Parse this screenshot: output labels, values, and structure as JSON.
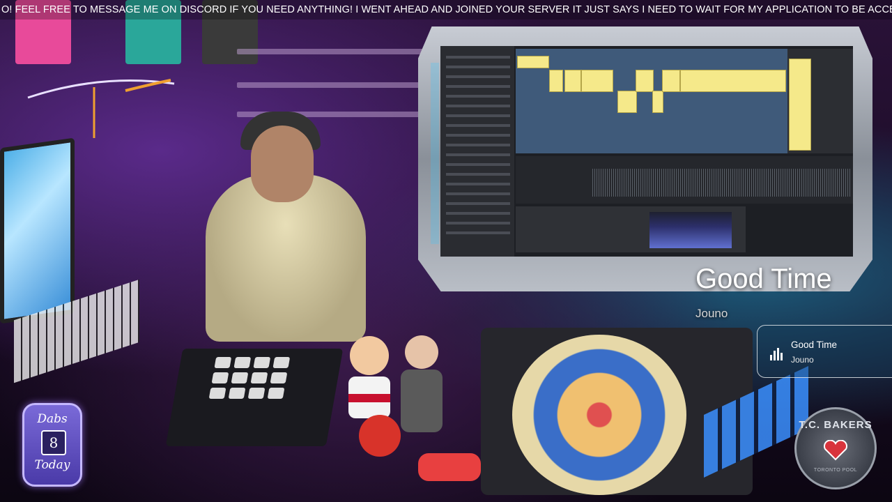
{
  "ticker": {
    "text": "O! FEEL FREE TO MESSAGE ME ON DISCORD IF YOU NEED ANYTHING! I WENT AHEAD AND JOINED YOUR SERVER IT JUST SAYS I NEED TO WAIT FOR MY APPLICATION TO BE ACCEPTED!"
  },
  "now_playing": {
    "title": "Good Time",
    "artist": "Jouno"
  },
  "now_playing_widget": {
    "title": "Good Time",
    "artist": "Jouno",
    "icon": "equalizer-bars-icon"
  },
  "dabs_badge": {
    "top": "Dabs",
    "count": "8",
    "bottom": "Today"
  },
  "logo": {
    "text": "T.C. BAKERS",
    "sub": "TORONTO POOL"
  },
  "colors": {
    "accent_purple": "#7a6ad8",
    "clip_yellow": "#f5e98a",
    "screen_glow": "#38c8ff"
  }
}
